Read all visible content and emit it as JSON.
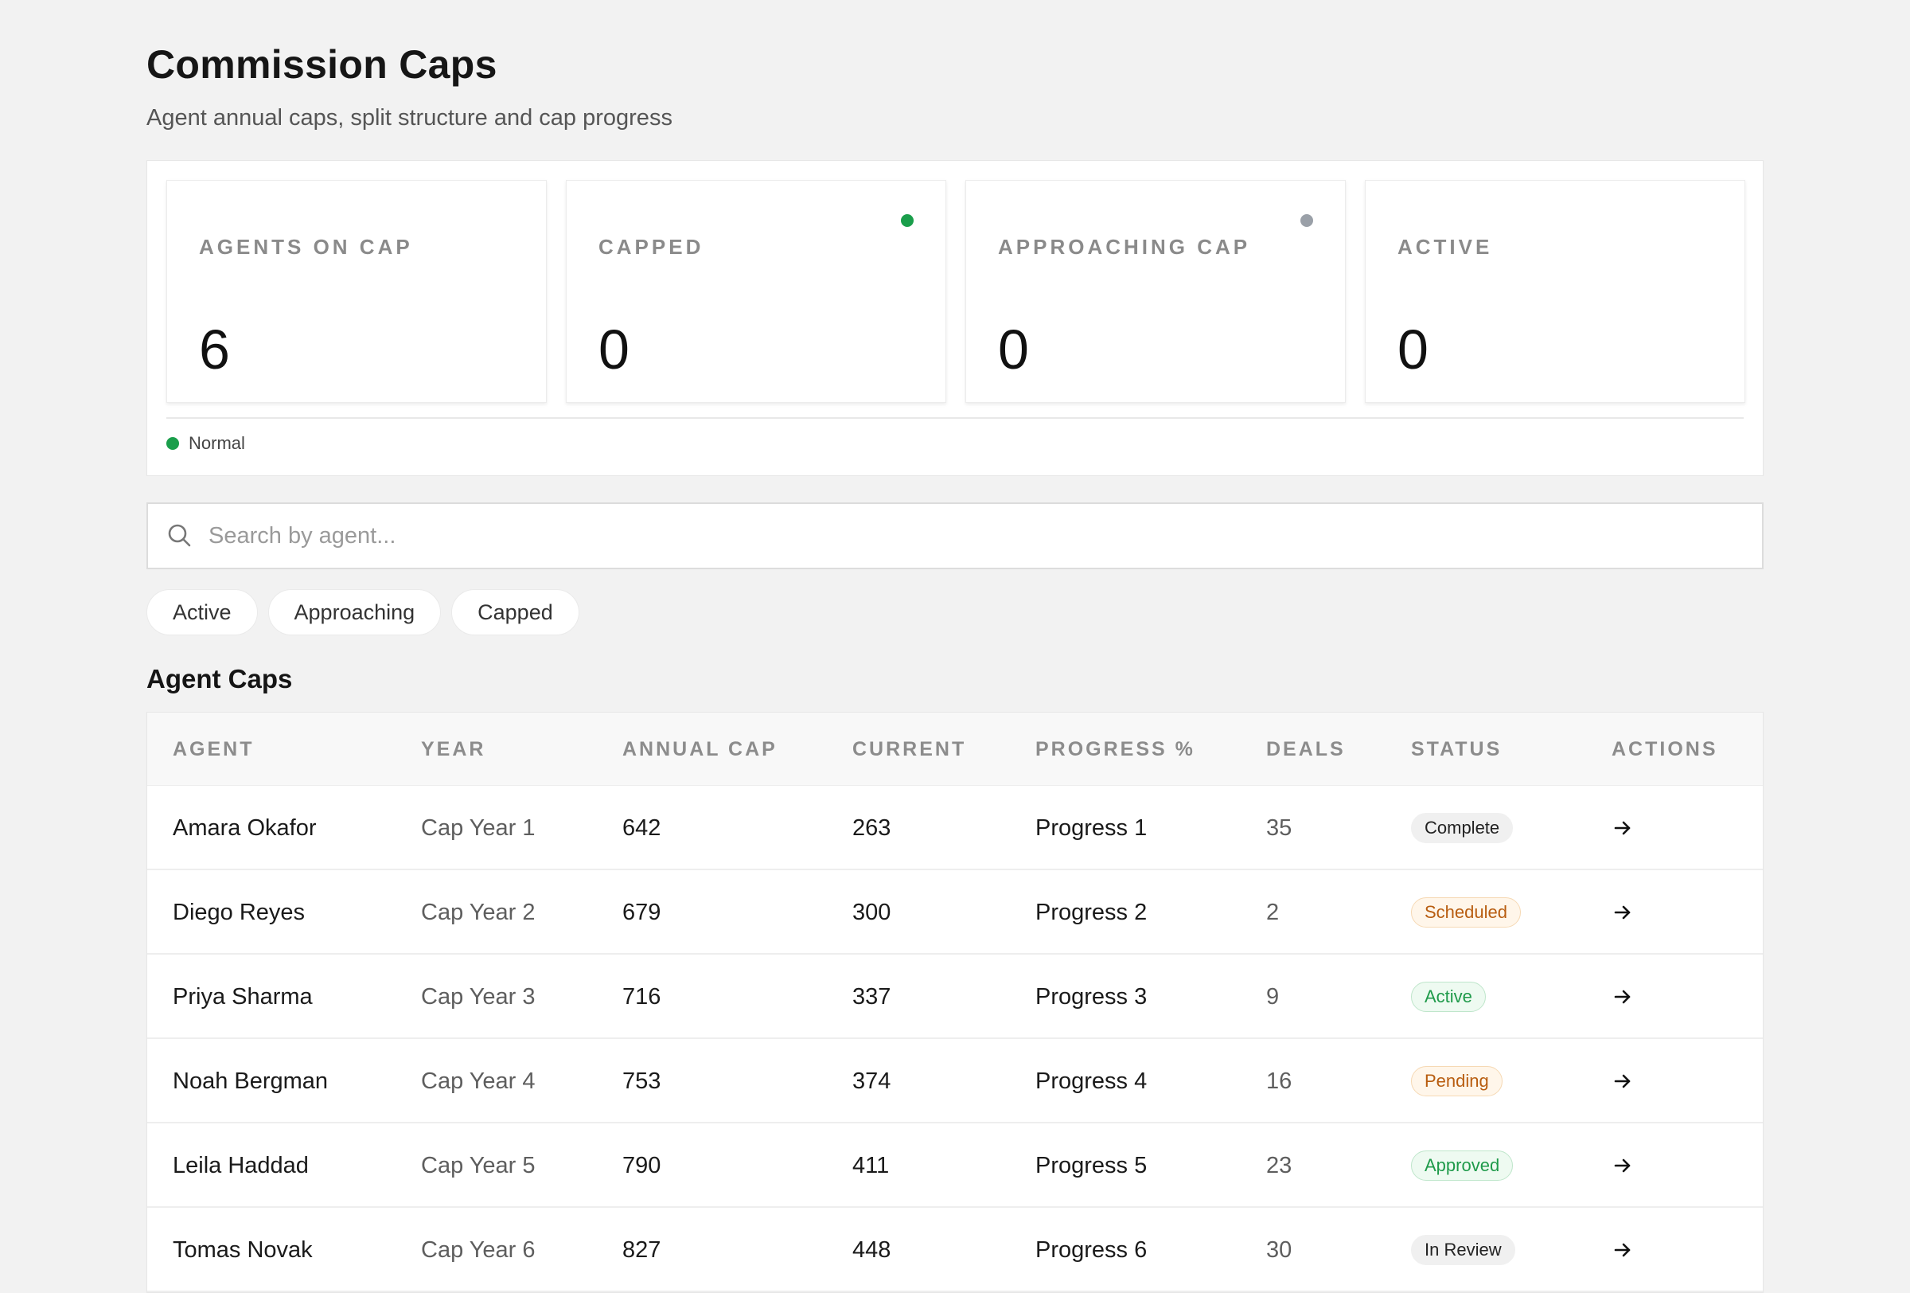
{
  "header": {
    "title": "Commission Caps",
    "subtitle": "Agent annual caps, split structure and cap progress"
  },
  "summary": {
    "cards": [
      {
        "label": "AGENTS ON CAP",
        "value": "6",
        "dot": null
      },
      {
        "label": "CAPPED",
        "value": "0",
        "dot": "#1a9e4b"
      },
      {
        "label": "APPROACHING CAP",
        "value": "0",
        "dot": "#9aa0a8"
      },
      {
        "label": "ACTIVE",
        "value": "0",
        "dot": null
      }
    ],
    "legend": {
      "label": "Normal",
      "color": "#1a9e4b"
    }
  },
  "search": {
    "placeholder": "Search by agent...",
    "value": ""
  },
  "filters": [
    "Active",
    "Approaching",
    "Capped"
  ],
  "table": {
    "title": "Agent Caps",
    "columns": [
      "AGENT",
      "YEAR",
      "ANNUAL CAP",
      "CURRENT",
      "PROGRESS %",
      "DEALS",
      "STATUS",
      "ACTIONS"
    ],
    "rows": [
      {
        "agent": "Amara Okafor",
        "year": "Cap Year 1",
        "annual_cap": "642",
        "current": "263",
        "progress": "Progress 1",
        "deals": "35",
        "status": "Complete"
      },
      {
        "agent": "Diego Reyes",
        "year": "Cap Year 2",
        "annual_cap": "679",
        "current": "300",
        "progress": "Progress 2",
        "deals": "2",
        "status": "Scheduled"
      },
      {
        "agent": "Priya Sharma",
        "year": "Cap Year 3",
        "annual_cap": "716",
        "current": "337",
        "progress": "Progress 3",
        "deals": "9",
        "status": "Active"
      },
      {
        "agent": "Noah Bergman",
        "year": "Cap Year 4",
        "annual_cap": "753",
        "current": "374",
        "progress": "Progress 4",
        "deals": "16",
        "status": "Pending"
      },
      {
        "agent": "Leila Haddad",
        "year": "Cap Year 5",
        "annual_cap": "790",
        "current": "411",
        "progress": "Progress 5",
        "deals": "23",
        "status": "Approved"
      },
      {
        "agent": "Tomas Novak",
        "year": "Cap Year 6",
        "annual_cap": "827",
        "current": "448",
        "progress": "Progress 6",
        "deals": "30",
        "status": "In Review"
      }
    ]
  },
  "status_styles": {
    "Complete": {
      "bg": "#f0f0f0",
      "fg": "#222222",
      "border": "#f0f0f0"
    },
    "Scheduled": {
      "bg": "#fff6ea",
      "fg": "#b85d10",
      "border": "#f6d9b4"
    },
    "Active": {
      "bg": "#eefaf1",
      "fg": "#1f9a4a",
      "border": "#bfe6cb"
    },
    "Pending": {
      "bg": "#fff6ea",
      "fg": "#b85d10",
      "border": "#f6d9b4"
    },
    "Approved": {
      "bg": "#eefaf1",
      "fg": "#1f9a4a",
      "border": "#bfe6cb"
    },
    "In Review": {
      "bg": "#f0f0f0",
      "fg": "#222222",
      "border": "#f0f0f0"
    }
  },
  "icons": {
    "search": "search-icon",
    "row_action": "arrow-right-icon"
  }
}
